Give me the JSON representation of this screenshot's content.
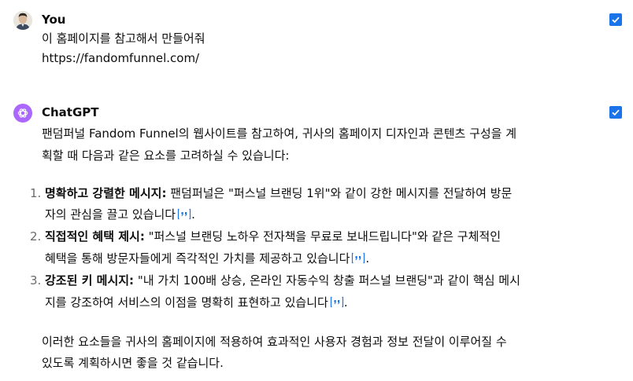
{
  "user": {
    "name": "You",
    "lines": [
      "이 홈페이지를 참고해서 만들어줘",
      "https://fandomfunnel.com/"
    ]
  },
  "assistant": {
    "name": "ChatGPT",
    "intro": [
      "팬덤퍼널 Fandom Funnel의 웹사이트를 참고하여, 귀사의 홈페이지 디자인과 콘텐츠 구성을 계",
      "획할 때 다음과 같은 요소를 고려하실 수 있습니다:"
    ],
    "items": [
      {
        "num": "1.",
        "bold": "명확하고 강렬한 메시지:",
        "rest": " 팬덤퍼널은 \"퍼스널 브랜딩 1위\"와 같이 강한 메시지를 전달하여 방문",
        "cont": "자의 관심을 끌고 있습니다",
        "end": "."
      },
      {
        "num": "2.",
        "bold": "직접적인 혜택 제시:",
        "rest": " \"퍼스널 브랜딩 노하우 전자책을 무료로 보내드립니다\"와 같은 구체적인",
        "cont": "혜택을 통해 방문자들에게 즉각적인 가치를 제공하고 있습니다",
        "end": "."
      },
      {
        "num": "3.",
        "bold": "강조된 키 메시지:",
        "rest": " \"내 가치 100배 상승, 온라인 자동수익 창출 퍼스널 브랜딩\"과 같이 핵심 메시",
        "cont": "지를 강조하여 서비스의 이점을 명확히 표현하고 있습니다",
        "end": "."
      }
    ],
    "outro": [
      "이러한 요소들을 귀사의 홈페이지에 적용하여 효과적인 사용자 경험과 정보 전달이 이루어질 수",
      "있도록 계획하시면 좋을 것 같습니다."
    ]
  },
  "colors": {
    "checkbox": "#1a73e8",
    "gpt_avatar": "#ab68ff",
    "list_number": "#6b6b6b"
  },
  "icons": {
    "user_avatar": "user-avatar-photo",
    "gpt_avatar": "openai-logo-icon",
    "checkbox": "checkmark-icon",
    "citation": "quote-citation-icon"
  }
}
